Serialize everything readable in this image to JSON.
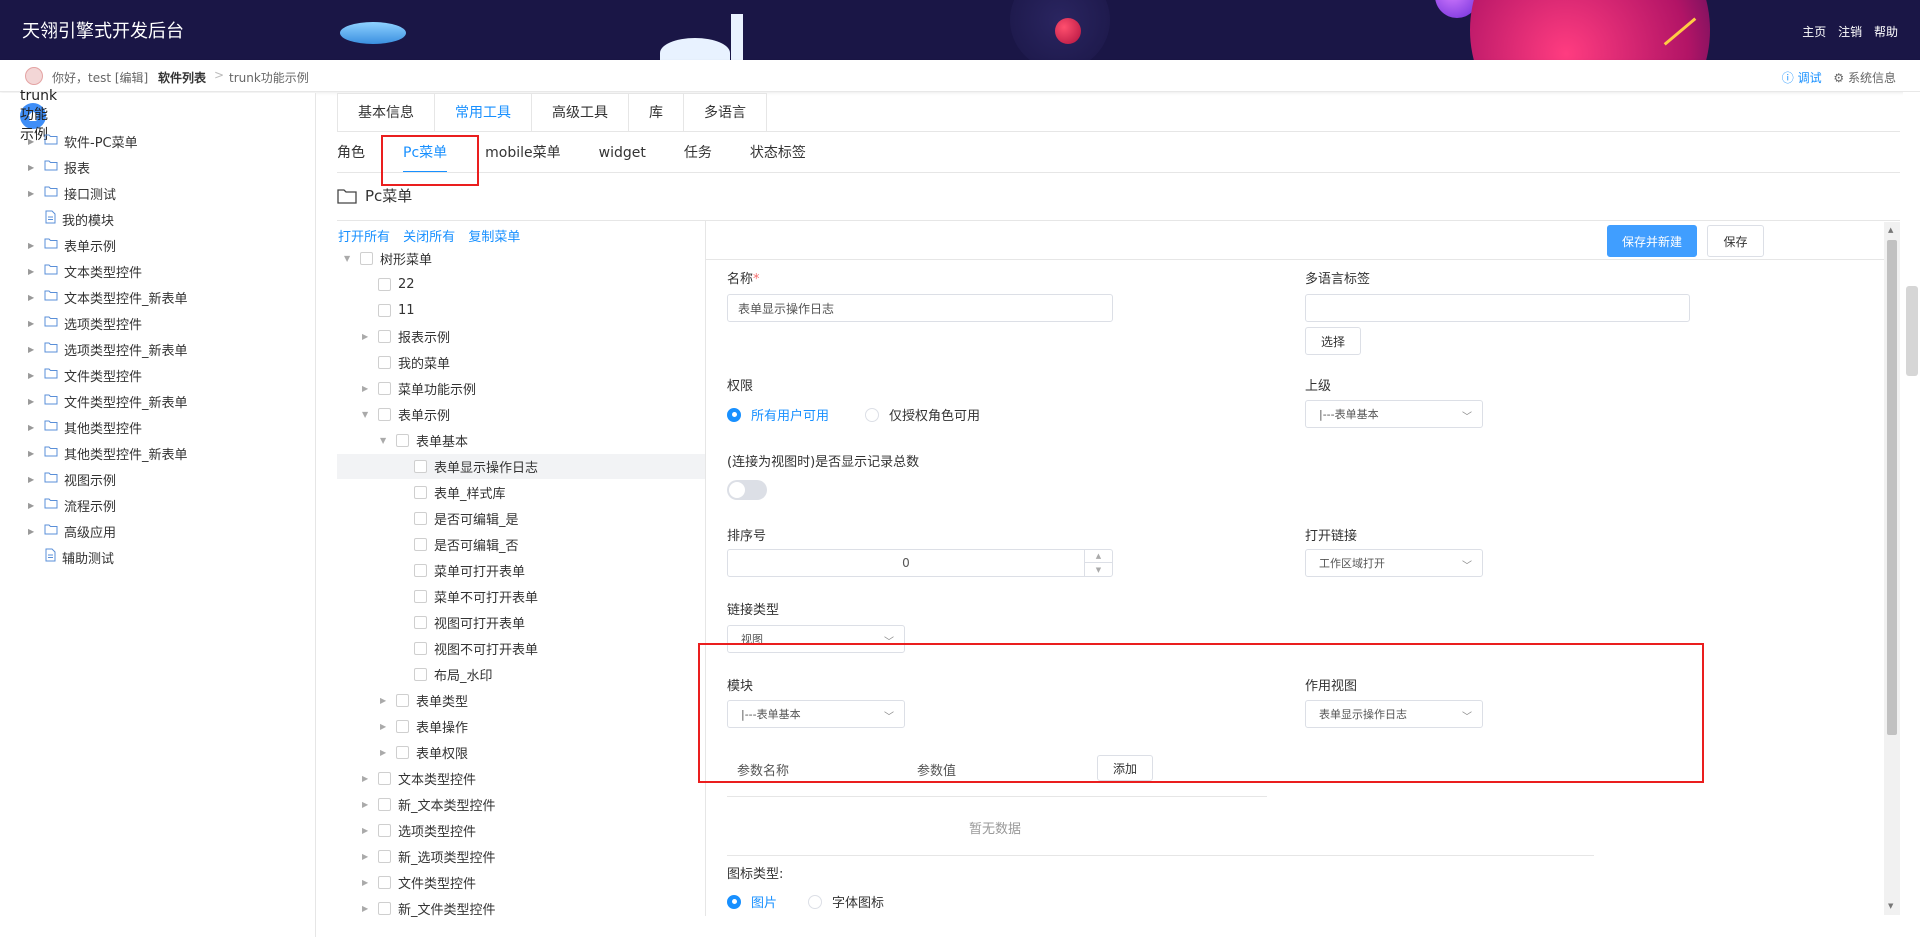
{
  "header": {
    "title": "天翎引擎式开发后台",
    "links": [
      "主页",
      "注销",
      "帮助"
    ]
  },
  "crumb": {
    "greeting": "你好，test [编辑]",
    "software_list": "软件列表",
    "separator": ">",
    "current": "trunk功能示例",
    "debug": "ⓘ 调试",
    "sysinfo": "⚙ 系统信息"
  },
  "sidebar": {
    "root": "trunk功能示例",
    "items": [
      {
        "label": "软件-PC菜单",
        "type": "folder"
      },
      {
        "label": "报表",
        "type": "folder"
      },
      {
        "label": "接口测试",
        "type": "folder"
      },
      {
        "label": "我的模块",
        "type": "file"
      },
      {
        "label": "表单示例",
        "type": "folder"
      },
      {
        "label": "文本类型控件",
        "type": "folder"
      },
      {
        "label": "文本类型控件_新表单",
        "type": "folder"
      },
      {
        "label": "选项类型控件",
        "type": "folder"
      },
      {
        "label": "选项类型控件_新表单",
        "type": "folder"
      },
      {
        "label": "文件类型控件",
        "type": "folder"
      },
      {
        "label": "文件类型控件_新表单",
        "type": "folder"
      },
      {
        "label": "其他类型控件",
        "type": "folder"
      },
      {
        "label": "其他类型控件_新表单",
        "type": "folder"
      },
      {
        "label": "视图示例",
        "type": "folder"
      },
      {
        "label": "流程示例",
        "type": "folder"
      },
      {
        "label": "高级应用",
        "type": "folder"
      },
      {
        "label": "辅助测试",
        "type": "file"
      }
    ]
  },
  "tabs_primary": [
    "基本信息",
    "常用工具",
    "高级工具",
    "库",
    "多语言"
  ],
  "tabs_secondary": [
    "角色",
    "Pc菜单",
    "mobile菜单",
    "widget",
    "任务",
    "状态标签"
  ],
  "section_title": "Pc菜单",
  "tree_actions": [
    "打开所有",
    "关闭所有",
    "复制菜单"
  ],
  "menu_tree": [
    {
      "label": "树形菜单",
      "level": 0,
      "arrow": "▼"
    },
    {
      "label": "22",
      "level": 1,
      "arrow": ""
    },
    {
      "label": "11",
      "level": 1,
      "arrow": ""
    },
    {
      "label": "报表示例",
      "level": 1,
      "arrow": "▶"
    },
    {
      "label": "我的菜单",
      "level": 1,
      "arrow": ""
    },
    {
      "label": "菜单功能示例",
      "level": 1,
      "arrow": "▶"
    },
    {
      "label": "表单示例",
      "level": 1,
      "arrow": "▼"
    },
    {
      "label": "表单基本",
      "level": 2,
      "arrow": "▼"
    },
    {
      "label": "表单显示操作日志",
      "level": 3,
      "arrow": ""
    },
    {
      "label": "表单_样式库",
      "level": 3,
      "arrow": ""
    },
    {
      "label": "是否可编辑_是",
      "level": 3,
      "arrow": ""
    },
    {
      "label": "是否可编辑_否",
      "level": 3,
      "arrow": ""
    },
    {
      "label": "菜单可打开表单",
      "level": 3,
      "arrow": ""
    },
    {
      "label": "菜单不可打开表单",
      "level": 3,
      "arrow": ""
    },
    {
      "label": "视图可打开表单",
      "level": 3,
      "arrow": ""
    },
    {
      "label": "视图不可打开表单",
      "level": 3,
      "arrow": ""
    },
    {
      "label": "布局_水印",
      "level": 3,
      "arrow": ""
    },
    {
      "label": "表单类型",
      "level": 2,
      "arrow": "▶"
    },
    {
      "label": "表单操作",
      "level": 2,
      "arrow": "▶"
    },
    {
      "label": "表单权限",
      "level": 2,
      "arrow": "▶"
    },
    {
      "label": "文本类型控件",
      "level": 1,
      "arrow": "▶"
    },
    {
      "label": "新_文本类型控件",
      "level": 1,
      "arrow": "▶"
    },
    {
      "label": "选项类型控件",
      "level": 1,
      "arrow": "▶"
    },
    {
      "label": "新_选项类型控件",
      "level": 1,
      "arrow": "▶"
    },
    {
      "label": "文件类型控件",
      "level": 1,
      "arrow": "▶"
    },
    {
      "label": "新_文件类型控件",
      "level": 1,
      "arrow": "▶"
    }
  ],
  "form": {
    "save_new": "保存并新建",
    "save": "保存",
    "name_label": "名称",
    "required_mark": "*",
    "name_value": "表单显示操作日志",
    "i18n_label": "多语言标签",
    "i18n_value": "",
    "choose": "选择",
    "permission_label": "权限",
    "perm_all": "所有用户可用",
    "perm_role": "仅授权角色可用",
    "parent_label": "上级",
    "parent_value": "|---表单基本",
    "show_total_label": "(连接为视图时)是否显示记录总数",
    "order_label": "排序号",
    "order_value": "0",
    "open_link_label": "打开链接",
    "open_link_value": "工作区域打开",
    "link_type_label": "链接类型",
    "link_type_value": "视图",
    "module_label": "模块",
    "module_value": "|---表单基本",
    "view_label": "作用视图",
    "view_value": "表单显示操作日志",
    "param_name": "参数名称",
    "param_value": "参数值",
    "add": "添加",
    "empty": "暂无数据",
    "icon_type_label": "图标类型:",
    "icon_img": "图片",
    "icon_font": "字体图标"
  }
}
